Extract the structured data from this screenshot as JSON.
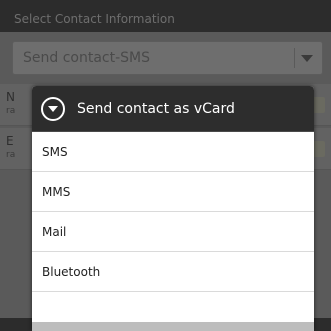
{
  "background": {
    "header_title": "Select Contact Information",
    "spinner_value": "Send contact-SMS",
    "rows": [
      {
        "line1": "N",
        "line2": "ra"
      },
      {
        "line1": "E",
        "line2": "ra"
      }
    ]
  },
  "dialog": {
    "title": "Send contact as vCard",
    "icon": "chevron-down-circle-icon",
    "options": [
      {
        "label": "SMS"
      },
      {
        "label": "MMS"
      },
      {
        "label": "Mail"
      },
      {
        "label": "Bluetooth"
      }
    ]
  },
  "colors": {
    "title_bar": "#2d2d2d",
    "dialog_bg": "#ffffff",
    "dim_bg": "#4e4e4e"
  }
}
